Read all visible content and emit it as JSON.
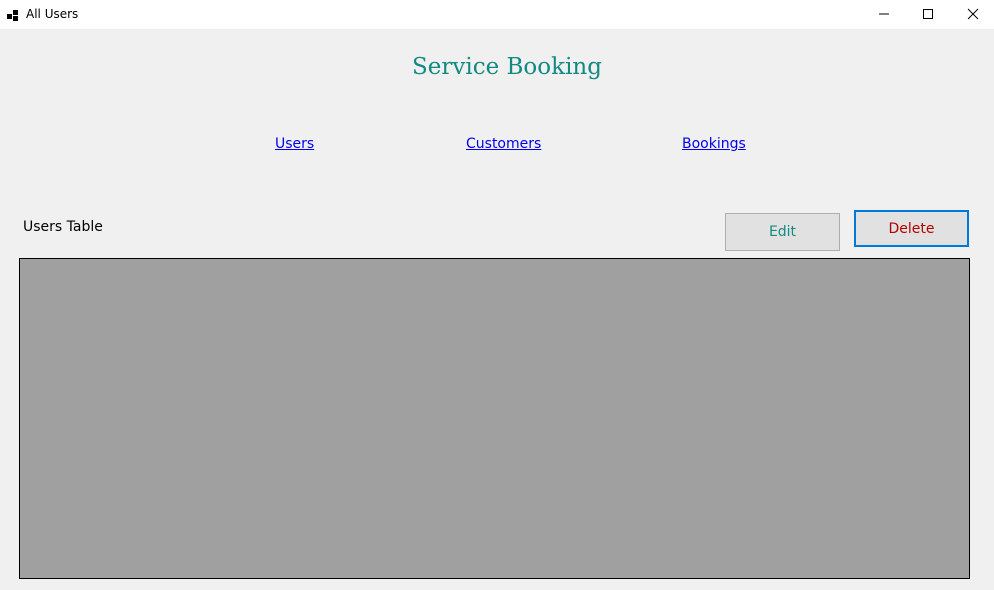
{
  "window": {
    "title": "All Users",
    "icons": {
      "app": "app-window-icon",
      "minimize": "minimize-icon",
      "maximize": "maximize-icon",
      "close": "close-icon"
    }
  },
  "header": {
    "title": "Service Booking"
  },
  "nav": {
    "users": "Users",
    "customers": "Customers",
    "bookings": "Bookings"
  },
  "table_section": {
    "label": "Users Table",
    "edit_label": "Edit",
    "delete_label": "Delete"
  },
  "colors": {
    "accent": "#118a82",
    "link": "#0000ee",
    "delete_text": "#b30000",
    "focus_border": "#0078d7",
    "grid_background": "#a0a0a0"
  }
}
